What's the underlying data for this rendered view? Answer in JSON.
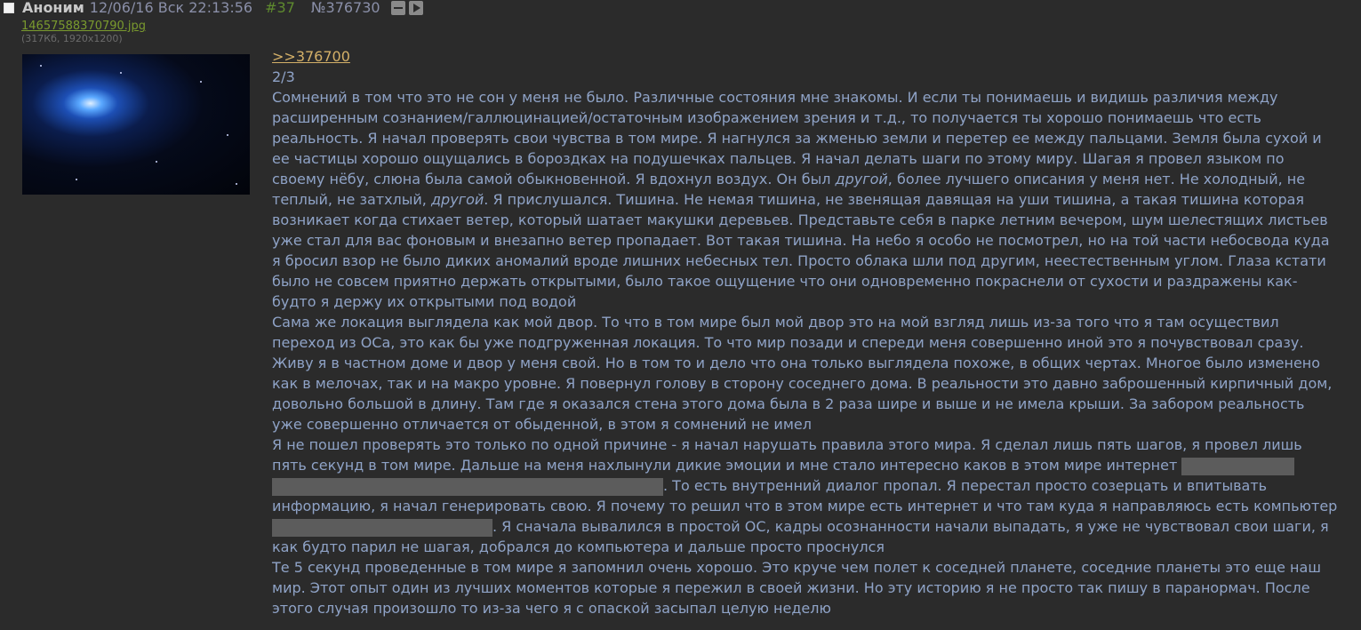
{
  "header": {
    "author": "Аноним",
    "date": "12/06/16 Вск 22:13:56",
    "post_index": "#37",
    "post_id": "№376730"
  },
  "file": {
    "name": "14657588370790.jpg",
    "meta": "(317Кб, 1920x1200)"
  },
  "post": {
    "reply_link": ">>376700",
    "counter": "2/3",
    "p1_a": "Сомнений в том что это не сон у меня не было. Различные состояния мне знакомы. И если ты понимаешь и видишь различия между расширенным сознанием/галлюцинацией/остаточным изображением зрения и т.д., то получается ты хорошо понимаешь что есть реальность. Я начал проверять свои чувства в том мире. Я нагнулся за жменью земли и перетер ее между пальцами. Земля была сухой и ее частицы хорошо ощущались в бороздках на подушечках пальцев. Я начал делать шаги по этому миру. Шагая я провел языком по своему нёбу, слюна была самой обыкновенной. Я вдохнул воздух. Он был ",
    "em1": "другой",
    "p1_b": ", более лучшего описания у меня нет. Не холодный, не теплый, не затхлый, ",
    "em2": "другой",
    "p1_c": ". Я прислушался. Тишина. Не немая тишина, не звенящая давящая на уши тишина, а такая тишина которая возникает когда стихает ветер, который шатает макушки деревьев. Представьте себя в парке летним вечером, шум шелестящих листьев уже стал для вас фоновым и внезапно ветер пропадает. Вот такая тишина. На небо я особо не посмотрел, но на той части небосвода куда я бросил взор не было диких аномалий вроде лишних небесных тел. Просто облака шли под другим, неестественным углом. Глаза кстати было не совсем приятно держать открытыми, было такое ощущение что они одновременно покраснели от сухости и раздражены как-будто я держу их открытыми под водой",
    "p2": "Сама же локация выглядела как мой двор. То что в том мире был мой двор это на мой взгляд лишь из-за того что я там осуществил переход из ОСа, это как бы уже подгруженная локация. То что мир позади и спереди меня совершенно иной это я почувствовал сразу. Живу я в частном доме и двор у меня свой. Но в том то и дело что она только выглядела похоже, в общих чертах. Многое было изменено как в мелочах, так и на макро уровне. Я повернул голову в сторону соседнего дома. В реальности это давно заброшенный кирпичный дом, довольно большой в длину. Там где я оказался стена этого дома была в 2 раза шире и выше и не имела крыши. За забором реальность уже совершенно отличается от обыденной, в этом я сомнений не имел",
    "p3_a": "Я не пошел проверять это только по одной причине - я начал нарушать правила этого мира. Я сделал лишь пять шагов, я провел лишь пять секунд в том мире. Дальше на меня нахлынули дикие эмоции и мне стало интересно каков в этом мире интернет ",
    "p3_b": ". То есть внутренний диалог пропал. Я перестал просто созерцать и впитывать информацию, я начал генерировать свою. Я почему то решил что в этом мире есть интернет и что там куда я направляюсь есть компьютер ",
    "p3_c": ". Я сначала вывалился в простой ОС, кадры осознанности начали выпадать, я уже не чувствовал свои шаги, я как будто парил не шагая, добрался до компьютера и дальше просто проснулся",
    "p4": "Те 5 секунд проведенные в том мире я запомнил очень хорошо. Это круче чем полет к соседней планете, соседние планеты это еще наш мир. Этот опыт один из лучших моментов которые я пережил в своей жизни. Но эту историю я не просто так пишу в паранормач. После этого случая произошло то из-за чего я с опаской засыпал целую неделю"
  },
  "colors": {
    "background": "#2b2b2b",
    "text": "#8fa3c7",
    "reply_link": "#d4b068",
    "file_link": "#7a9a2e",
    "post_index": "#5e8a2e",
    "spoiler": "#5c5c5c"
  },
  "icons": [
    "checkbox-icon",
    "hide-icon",
    "play-icon"
  ]
}
